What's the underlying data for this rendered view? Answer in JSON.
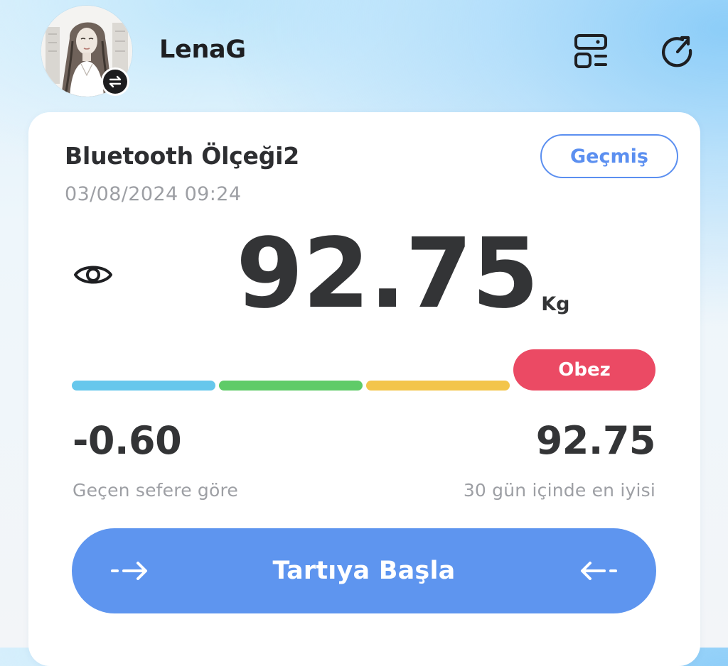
{
  "header": {
    "username": "LenaG"
  },
  "icons": {
    "avatar": "user-avatar-portrait",
    "switch": "switch-user-icon",
    "devices": "device-list-icon",
    "sync": "refresh-icon",
    "eye": "eye-icon",
    "arrow_in_left": "arrow-right-icon",
    "arrow_in_right": "arrow-left-icon"
  },
  "card": {
    "device_name": "Bluetooth Ölçeği2",
    "timestamp": "03/08/2024 09:24",
    "history_label": "Geçmiş",
    "weight": "92.75",
    "unit": "Kg",
    "bmi_status": "Obez",
    "bmi_colors": [
      "#66c7ec",
      "#5fcb68",
      "#f3c54b",
      "#eb4a64"
    ],
    "change_value": "-0.60",
    "change_label": "Geçen sefere göre",
    "best_value": "92.75",
    "best_label": "30 gün içinde en iyisi",
    "start_label": "Tartıya Başla"
  },
  "colors": {
    "accent": "#5e95ef",
    "obese": "#eb4a64",
    "text_dark": "#333436",
    "text_muted": "#9d9fa4"
  }
}
